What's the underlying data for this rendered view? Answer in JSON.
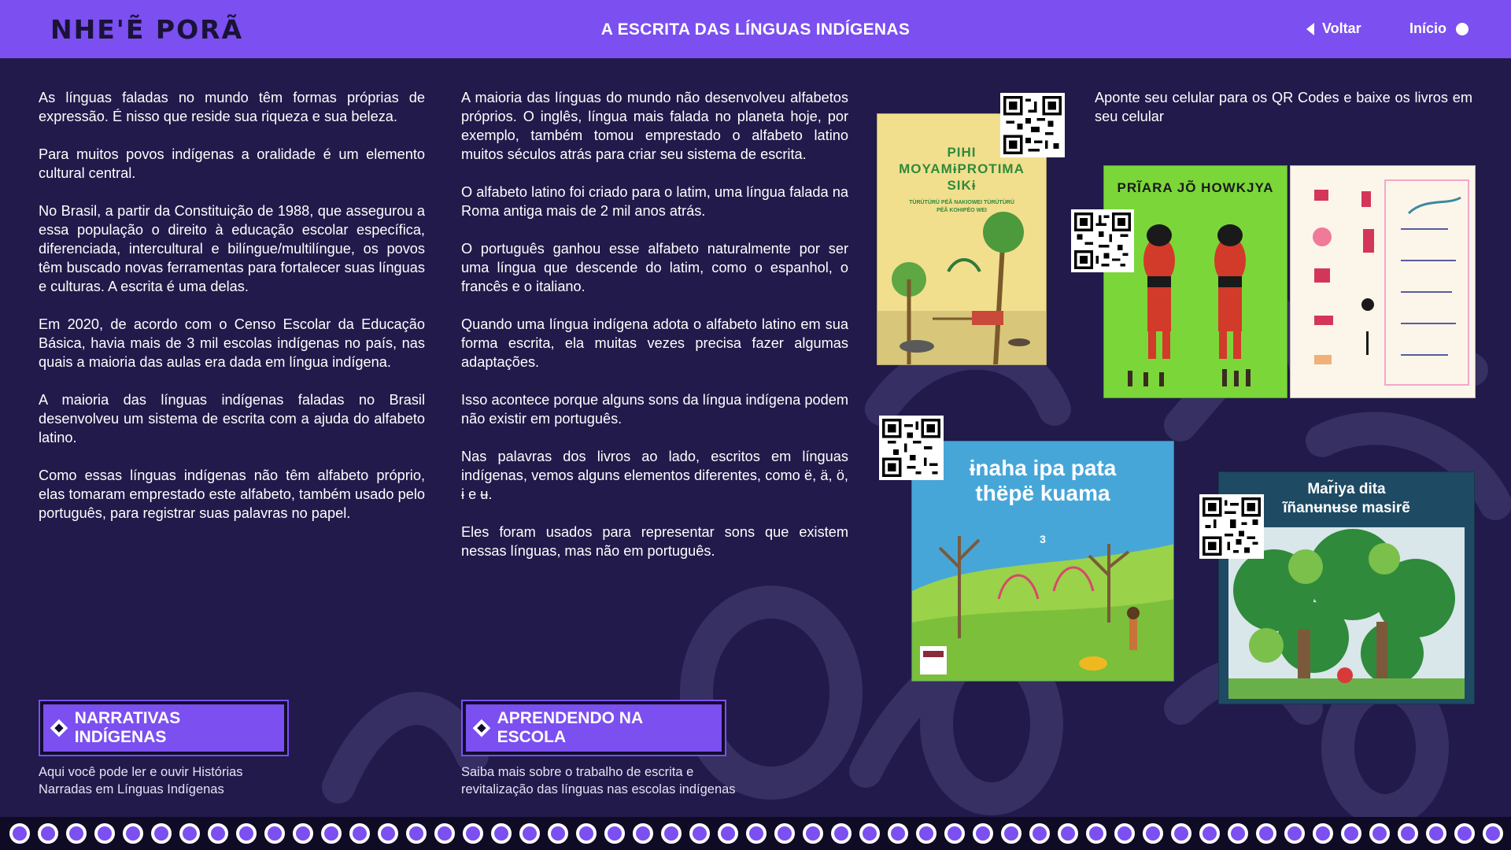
{
  "header": {
    "logo": "NHE'Ẽ PORÃ",
    "title": "A ESCRITA DAS LÍNGUAS INDÍGENAS",
    "back_label": "Voltar",
    "home_label": "Início"
  },
  "column1": {
    "paragraphs": [
      "As línguas faladas no mundo têm formas próprias de expressão. É nisso que reside sua riqueza e sua beleza.",
      "Para muitos povos indígenas a oralidade é um elemento cultural central.",
      "No Brasil, a partir da Constituição de 1988, que assegurou a essa população o direito à educação escolar específica, diferenciada, intercultural e bilíngue/multilíngue, os povos têm buscado novas ferramentas para fortalecer suas línguas e culturas. A escrita é uma delas.",
      "Em 2020, de acordo com o Censo Escolar da Educação Básica, havia mais de 3 mil escolas indígenas no país, nas quais a maioria das aulas era dada em língua indígena.",
      "A maioria das línguas indígenas faladas no Brasil desenvolveu um sistema de escrita com a ajuda do alfabeto latino.",
      "Como essas línguas indígenas não têm alfabeto próprio, elas tomaram emprestado este alfabeto, também usado pelo português, para registrar suas palavras no papel."
    ]
  },
  "column2": {
    "paragraphs": [
      "A maioria das línguas do mundo não desenvolveu alfabetos próprios. O inglês, língua mais falada no planeta hoje, por exemplo, também tomou emprestado o alfabeto latino muitos séculos atrás para criar seu sistema de escrita.",
      "O alfabeto latino foi criado para o latim, uma língua falada na Roma antiga mais de 2 mil anos atrás.",
      "O português ganhou esse alfabeto naturalmente por ser uma língua que descende do latim, como o espanhol, o francês e o italiano.",
      "Quando uma língua indígena adota o alfabeto latino em sua forma escrita, ela muitas vezes precisa fazer algumas adaptações.",
      "Isso acontece porque alguns sons da língua indígena podem não existir em português.",
      "Nas palavras dos livros ao lado, escritos em línguas indígenas, vemos alguns elementos diferentes, como ë, ä, ö, ɨ e ʉ.",
      "Eles foram usados para representar sons que existem nessas línguas, mas não em português."
    ]
  },
  "qr_caption": "Aponte seu celular para os QR Codes e baixe os livros em seu celular",
  "books": {
    "book1_title": "PIHI MOYAMɨPROTIMA SIKɨ",
    "book1_subtitle": "TÜRÜTÜRÜ PËÃ NAKIOWEI TÜRÜTÜRÜ PËÃ KOHIPËO WEI",
    "book2_title": "PRĨARA JÕ HOWKJYA",
    "book3_title": "ɨnaha ipa pata thëpë kuama",
    "book3_number": "3",
    "book4_title": "Mar̃iya dita ĩñanʉnʉse masirẽ"
  },
  "buttons": {
    "narrativas_label": "NARRATIVAS INDÍGENAS",
    "narrativas_desc_1": "Aqui você pode ler e ouvir Histórias",
    "narrativas_desc_2": "Narradas em Línguas Indígenas",
    "escola_label": "APRENDENDO NA ESCOLA",
    "escola_desc_1": "Saiba mais sobre o trabalho de escrita e",
    "escola_desc_2": "revitalização das línguas nas escolas indígenas"
  },
  "colors": {
    "header_bg": "#7b4ff0",
    "page_bg": "#211a4a",
    "accent": "#7b4ff0"
  }
}
